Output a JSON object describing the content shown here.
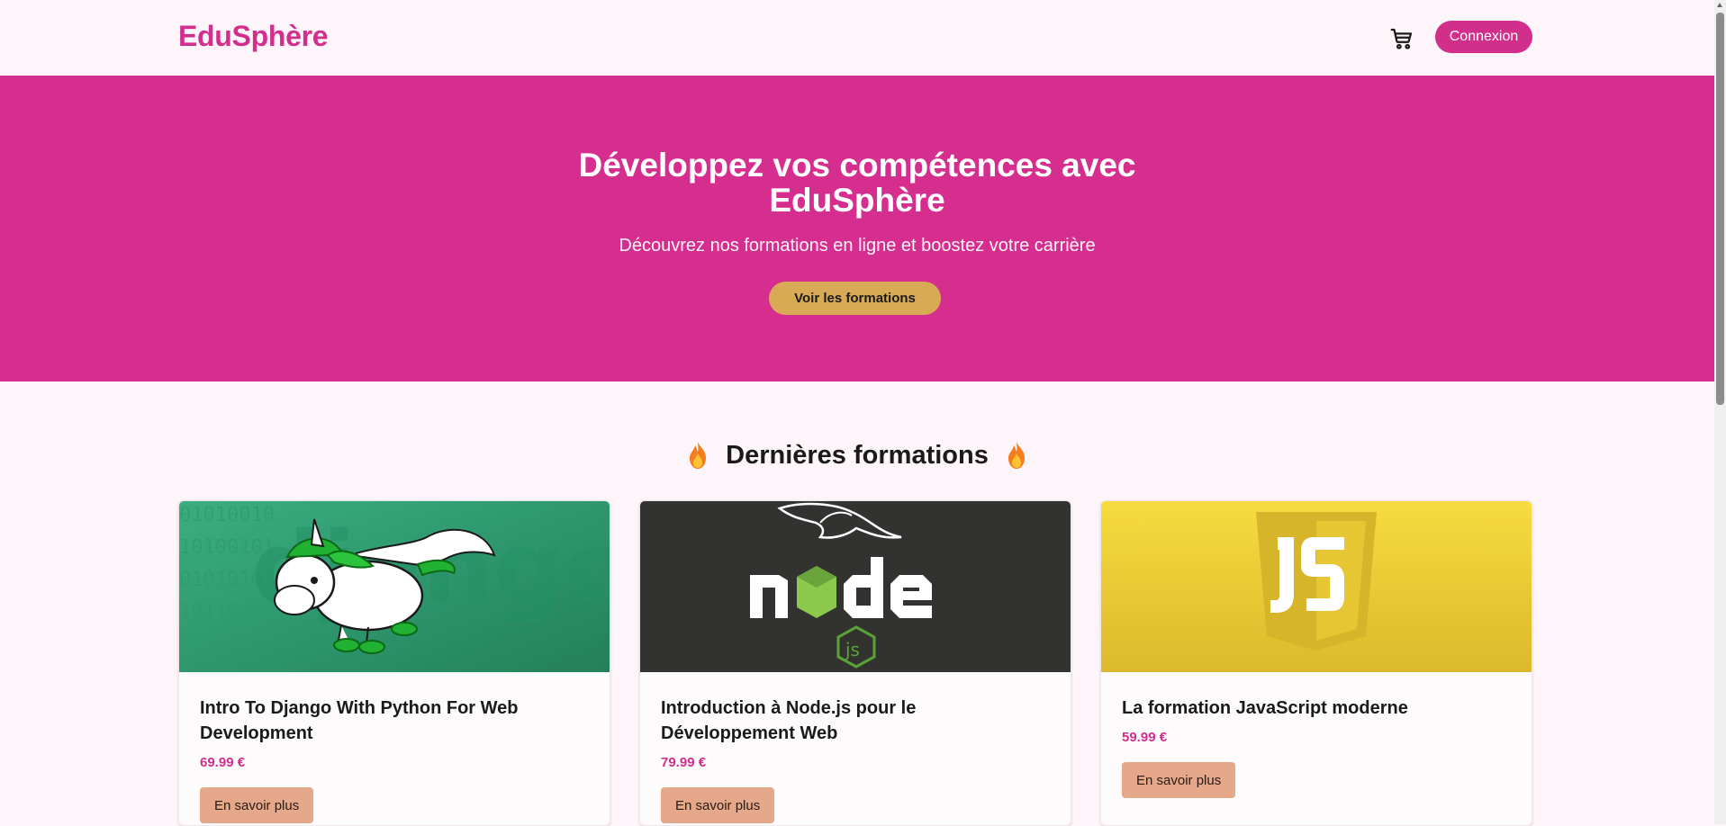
{
  "navbar": {
    "brand": "EduSphère",
    "cart_icon": "cart-icon",
    "login_label": "Connexion"
  },
  "hero": {
    "title_line1": "Développez vos compétences avec",
    "title_line2": "EduSphère",
    "subtitle": "Découvrez nos formations en ligne et boostez votre carrière",
    "cta_label": "Voir les formations"
  },
  "section": {
    "title": "Dernières formations",
    "icon": "fire-icon"
  },
  "courses": [
    {
      "title": "Intro To Django With Python For Web Development",
      "price": "69.99 €",
      "button_label": "En savoir plus",
      "image": "django-pony-logo"
    },
    {
      "title": "Introduction à Node.js pour le Développement Web",
      "price": "79.99 €",
      "button_label": "En savoir plus",
      "image": "nodejs-logo"
    },
    {
      "title": "La formation JavaScript moderne",
      "price": "59.99 €",
      "button_label": "En savoir plus",
      "image": "javascript-logo"
    }
  ],
  "colors": {
    "brand": "#d22f8d",
    "hero_bg": "#d52e8e",
    "cta": "#d8aa55",
    "card_button": "#e5a88a",
    "page_bg": "#fdf5f9"
  }
}
